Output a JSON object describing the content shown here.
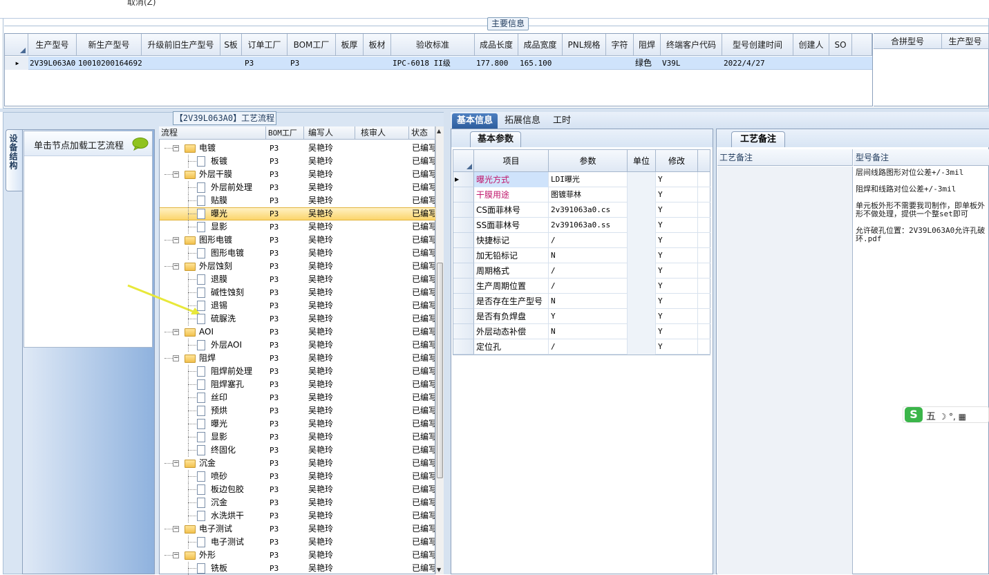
{
  "topbar": {
    "cancel_label": "取消(Z)"
  },
  "main_info": {
    "title": "主要信息",
    "columns": [
      "生产型号",
      "新生产型号",
      "升级前旧生产型号",
      "S板",
      "订单工厂",
      "BOM工厂",
      "板厚",
      "板材",
      "验收标准",
      "成品长度",
      "成品宽度",
      "PNL规格",
      "字符",
      "阻焊",
      "终端客户代码",
      "型号创建时间",
      "创建人",
      "SO"
    ],
    "row": {
      "model": "2V39L063A0",
      "new_model": "10010200164692",
      "order_factory": "P3",
      "bom_factory": "P3",
      "standard": "IPC-6018 II级",
      "length": "177.800",
      "width": "165.100",
      "mask": "绿色",
      "customer": "V39L",
      "created": "2022/4/27"
    },
    "side_columns": [
      "合拼型号",
      "生产型号"
    ]
  },
  "left": {
    "title": "【2V39L063A0】工艺流程",
    "vtab": "设备结构",
    "hint": "单击节点加载工艺流程"
  },
  "tree": {
    "headers": [
      "流程",
      "BOM工厂",
      "编写人",
      "核审人",
      "状态"
    ],
    "rows": [
      {
        "name": "电镀",
        "folder": true,
        "bom": "P3",
        "writer": "吴艳玲",
        "status": "已编写"
      },
      {
        "name": "板镀",
        "folder": false,
        "bom": "P3",
        "writer": "吴艳玲",
        "status": "已编写"
      },
      {
        "name": "外层干膜",
        "folder": true,
        "bom": "P3",
        "writer": "吴艳玲",
        "status": "已编写"
      },
      {
        "name": "外层前处理",
        "folder": false,
        "bom": "P3",
        "writer": "吴艳玲",
        "status": "已编写"
      },
      {
        "name": "贴膜",
        "folder": false,
        "bom": "P3",
        "writer": "吴艳玲",
        "status": "已编写"
      },
      {
        "name": "曝光",
        "folder": false,
        "bom": "P3",
        "writer": "吴艳玲",
        "status": "已编写",
        "selected": true
      },
      {
        "name": "显影",
        "folder": false,
        "bom": "P3",
        "writer": "吴艳玲",
        "status": "已编写"
      },
      {
        "name": "图形电镀",
        "folder": true,
        "bom": "P3",
        "writer": "吴艳玲",
        "status": "已编写"
      },
      {
        "name": "图形电镀",
        "folder": false,
        "bom": "P3",
        "writer": "吴艳玲",
        "status": "已编写"
      },
      {
        "name": "外层蚀刻",
        "folder": true,
        "bom": "P3",
        "writer": "吴艳玲",
        "status": "已编写"
      },
      {
        "name": "退膜",
        "folder": false,
        "bom": "P3",
        "writer": "吴艳玲",
        "status": "已编写"
      },
      {
        "name": "碱性蚀刻",
        "folder": false,
        "bom": "P3",
        "writer": "吴艳玲",
        "status": "已编写"
      },
      {
        "name": "退锡",
        "folder": false,
        "bom": "P3",
        "writer": "吴艳玲",
        "status": "已编写"
      },
      {
        "name": "硫脲洗",
        "folder": false,
        "bom": "P3",
        "writer": "吴艳玲",
        "status": "已编写"
      },
      {
        "name": "AOI",
        "folder": true,
        "bom": "P3",
        "writer": "吴艳玲",
        "status": "已编写"
      },
      {
        "name": "外层AOI",
        "folder": false,
        "bom": "P3",
        "writer": "吴艳玲",
        "status": "已编写"
      },
      {
        "name": "阻焊",
        "folder": true,
        "bom": "P3",
        "writer": "吴艳玲",
        "status": "已编写"
      },
      {
        "name": "阻焊前处理",
        "folder": false,
        "bom": "P3",
        "writer": "吴艳玲",
        "status": "已编写"
      },
      {
        "name": "阻焊塞孔",
        "folder": false,
        "bom": "P3",
        "writer": "吴艳玲",
        "status": "已编写"
      },
      {
        "name": "丝印",
        "folder": false,
        "bom": "P3",
        "writer": "吴艳玲",
        "status": "已编写"
      },
      {
        "name": "预烘",
        "folder": false,
        "bom": "P3",
        "writer": "吴艳玲",
        "status": "已编写"
      },
      {
        "name": "曝光",
        "folder": false,
        "bom": "P3",
        "writer": "吴艳玲",
        "status": "已编写"
      },
      {
        "name": "显影",
        "folder": false,
        "bom": "P3",
        "writer": "吴艳玲",
        "status": "已编写"
      },
      {
        "name": "终固化",
        "folder": false,
        "bom": "P3",
        "writer": "吴艳玲",
        "status": "已编写"
      },
      {
        "name": "沉金",
        "folder": true,
        "bom": "P3",
        "writer": "吴艳玲",
        "status": "已编写"
      },
      {
        "name": "喷砂",
        "folder": false,
        "bom": "P3",
        "writer": "吴艳玲",
        "status": "已编写"
      },
      {
        "name": "板边包胶",
        "folder": false,
        "bom": "P3",
        "writer": "吴艳玲",
        "status": "已编写"
      },
      {
        "name": "沉金",
        "folder": false,
        "bom": "P3",
        "writer": "吴艳玲",
        "status": "已编写"
      },
      {
        "name": "水洗烘干",
        "folder": false,
        "bom": "P3",
        "writer": "吴艳玲",
        "status": "已编写"
      },
      {
        "name": "电子测试",
        "folder": true,
        "bom": "P3",
        "writer": "吴艳玲",
        "status": "已编写"
      },
      {
        "name": "电子测试",
        "folder": false,
        "bom": "P3",
        "writer": "吴艳玲",
        "status": "已编写"
      },
      {
        "name": "外形",
        "folder": true,
        "bom": "P3",
        "writer": "吴艳玲",
        "status": "已编写"
      },
      {
        "name": "铣板",
        "folder": false,
        "bom": "P3",
        "writer": "吴艳玲",
        "status": "已编写"
      }
    ]
  },
  "right_tabs": [
    "基本信息",
    "拓展信息",
    "工时"
  ],
  "basic_params": {
    "tab": "基本参数",
    "headers": [
      "项目",
      "参数",
      "单位",
      "修改"
    ],
    "rows": [
      {
        "item": "曝光方式",
        "param": "LDI曝光",
        "unit": "",
        "mod": "Y",
        "highlight": true
      },
      {
        "item": "干膜用途",
        "param": "图镀菲林",
        "unit": "",
        "mod": "Y",
        "highlight": true
      },
      {
        "item": "CS面菲林号",
        "param": "2v391063a0.cs",
        "unit": "",
        "mod": "Y"
      },
      {
        "item": "SS面菲林号",
        "param": "2v391063a0.ss",
        "unit": "",
        "mod": "Y"
      },
      {
        "item": "快捷标记",
        "param": "/",
        "unit": "",
        "mod": "Y"
      },
      {
        "item": "加无铅标记",
        "param": "N",
        "unit": "",
        "mod": "Y"
      },
      {
        "item": "周期格式",
        "param": "/",
        "unit": "",
        "mod": "Y"
      },
      {
        "item": "生产周期位置",
        "param": "/",
        "unit": "",
        "mod": "Y"
      },
      {
        "item": "是否存在生产型号",
        "param": "N",
        "unit": "",
        "mod": "Y"
      },
      {
        "item": "是否有负焊盘",
        "param": "Y",
        "unit": "",
        "mod": "Y"
      },
      {
        "item": "外层动态补偿",
        "param": "N",
        "unit": "",
        "mod": "Y"
      },
      {
        "item": "定位孔",
        "param": "/",
        "unit": "",
        "mod": "Y"
      }
    ]
  },
  "notes": {
    "tab": "工艺备注",
    "col1": "工艺备注",
    "col2": "型号备注",
    "lines": [
      "层间线路图形对位公差+/-3mil",
      "阻焊和线路对位公差+/-3mil",
      "单元板外形不需要我司制作，即单板外",
      "形不做处理，提供一个整set即可",
      "允许破孔位置：2V39L063A0允许孔破",
      "环.pdf"
    ]
  },
  "ime": {
    "label": "五",
    "glyphs": "☽ °, ▦"
  }
}
